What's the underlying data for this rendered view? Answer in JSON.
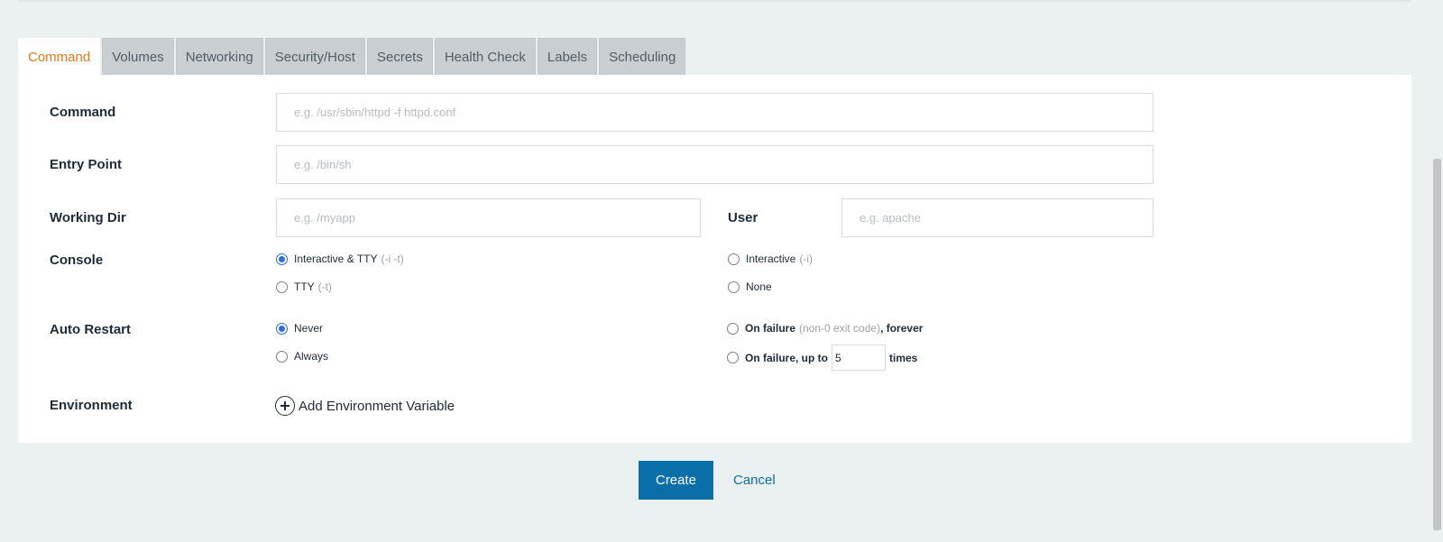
{
  "tabs": [
    {
      "label": "Command",
      "active": true
    },
    {
      "label": "Volumes"
    },
    {
      "label": "Networking"
    },
    {
      "label": "Security/Host"
    },
    {
      "label": "Secrets"
    },
    {
      "label": "Health Check"
    },
    {
      "label": "Labels"
    },
    {
      "label": "Scheduling"
    }
  ],
  "form": {
    "command": {
      "label": "Command",
      "placeholder": "e.g. /usr/sbin/httpd -f httpd.conf",
      "value": ""
    },
    "entry_point": {
      "label": "Entry Point",
      "placeholder": "e.g. /bin/sh",
      "value": ""
    },
    "working_dir": {
      "label": "Working Dir",
      "placeholder": "e.g. /myapp",
      "value": ""
    },
    "user": {
      "label": "User",
      "placeholder": "e.g. apache",
      "value": ""
    },
    "console": {
      "label": "Console",
      "options": [
        {
          "label": "Interactive & TTY",
          "hint": "(-i -t)",
          "checked": true
        },
        {
          "label": "Interactive",
          "hint": "(-i)",
          "checked": false
        },
        {
          "label": "TTY",
          "hint": "(-t)",
          "checked": false
        },
        {
          "label": "None",
          "hint": "",
          "checked": false
        }
      ]
    },
    "auto_restart": {
      "label": "Auto Restart",
      "never": "Never",
      "always": "Always",
      "on_failure_forever_prefix": "On failure",
      "on_failure_forever_hint": "(non-0 exit code)",
      "on_failure_forever_suffix": ", forever",
      "on_failure_upto_prefix": "On failure, up to",
      "on_failure_upto_value": "5",
      "on_failure_upto_suffix": "times",
      "selected": "Never"
    },
    "environment": {
      "label": "Environment",
      "add_label": "Add Environment Variable"
    }
  },
  "actions": {
    "create": "Create",
    "cancel": "Cancel"
  },
  "colors": {
    "accent_tab": "#e6781e",
    "primary": "#0a6ea8",
    "radio": "#2b6fd6"
  }
}
